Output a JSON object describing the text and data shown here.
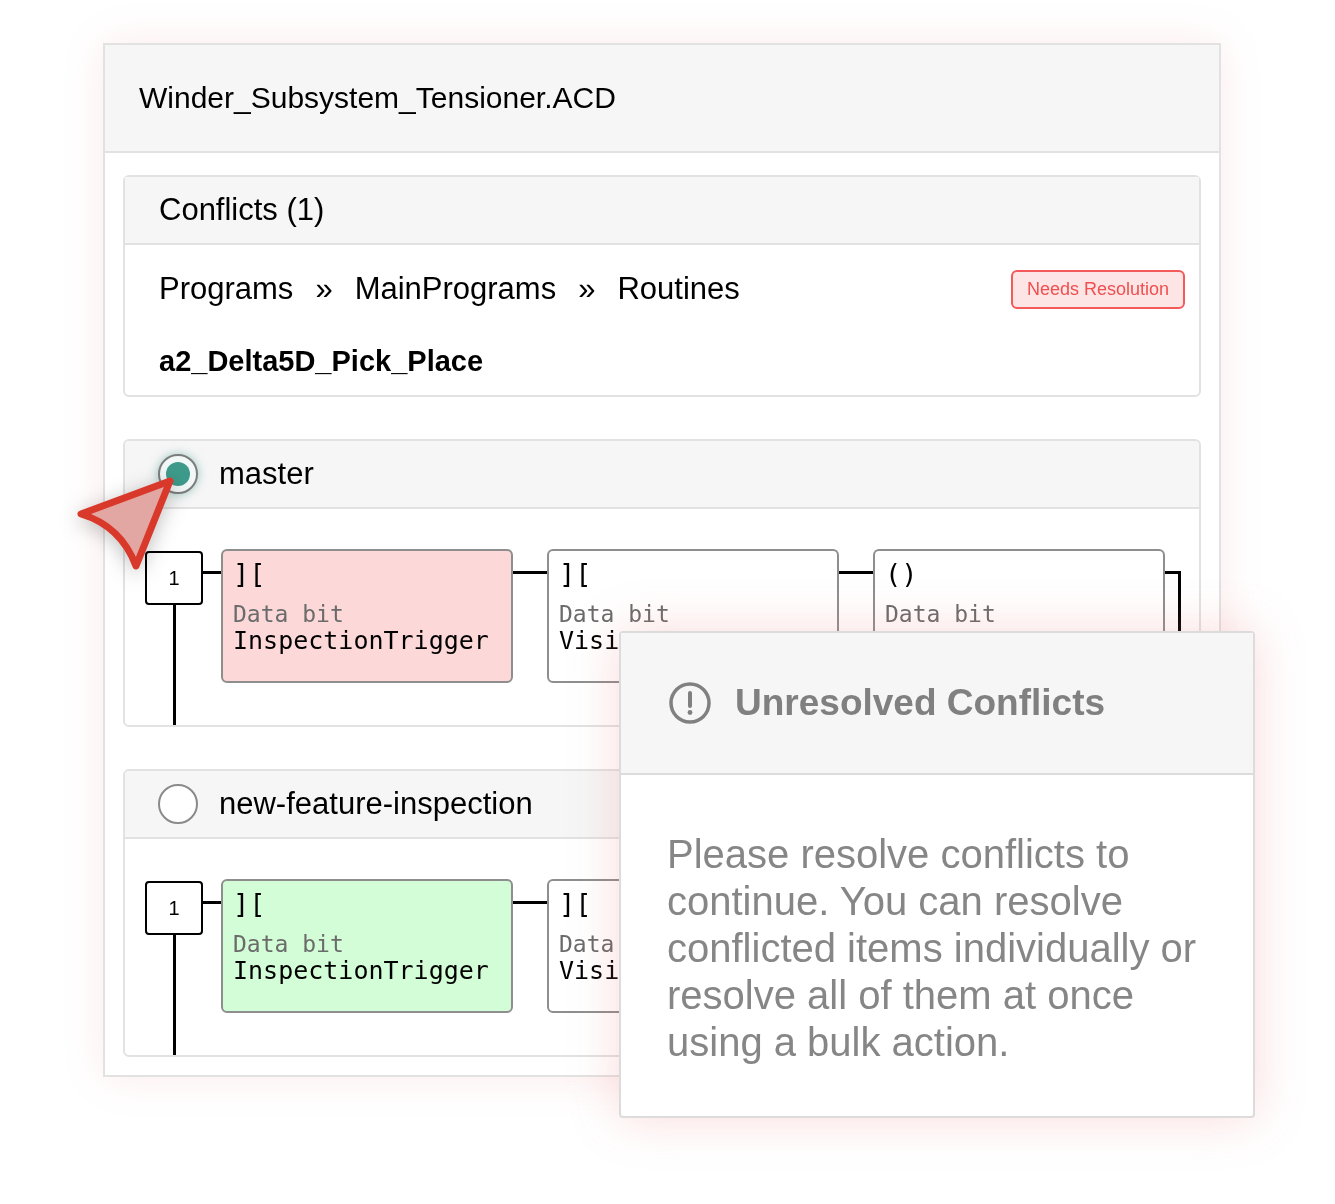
{
  "window": {
    "title": "Winder_Subsystem_Tensioner.ACD"
  },
  "conflicts": {
    "title": "Conflicts (1)",
    "path": [
      {
        "text": "Programs",
        "separator": "»"
      },
      {
        "text": "MainPrograms",
        "separator": "»"
      },
      {
        "text": "Routines"
      }
    ],
    "badge": "Needs Resolution",
    "routine": "a2_Delta5D_Pick_Place"
  },
  "branches": [
    {
      "name": "master",
      "selected": true,
      "rungs": [
        {
          "number": "1",
          "elements": [
            {
              "kind": "contact",
              "symbol": "][",
              "type_label": "Data bit",
              "tag": "InspectionTrigger",
              "color": "#fdd8d8"
            },
            {
              "kind": "contact",
              "symbol": "][",
              "type_label": "Data bit",
              "tag": "Visi",
              "color": "#ffffff"
            },
            {
              "kind": "coil",
              "symbol": "()",
              "type_label": "Data bit",
              "color": "#ffffff"
            }
          ]
        }
      ]
    },
    {
      "name": "new-feature-inspection",
      "selected": false,
      "rungs": [
        {
          "number": "1",
          "elements": [
            {
              "kind": "contact",
              "symbol": "][",
              "type_label": "Data bit",
              "tag": "InspectionTrigger",
              "color": "#d3fdd6"
            },
            {
              "kind": "contact",
              "symbol": "][",
              "type_label": "Data",
              "tag": "Visi",
              "color": "#ffffff"
            }
          ]
        }
      ]
    }
  ],
  "dialog": {
    "title": "Unresolved Conflicts",
    "message": "Please resolve conflicts to continue. You can resolve conflicted items individually or resolve all of them at once using a bulk action."
  }
}
